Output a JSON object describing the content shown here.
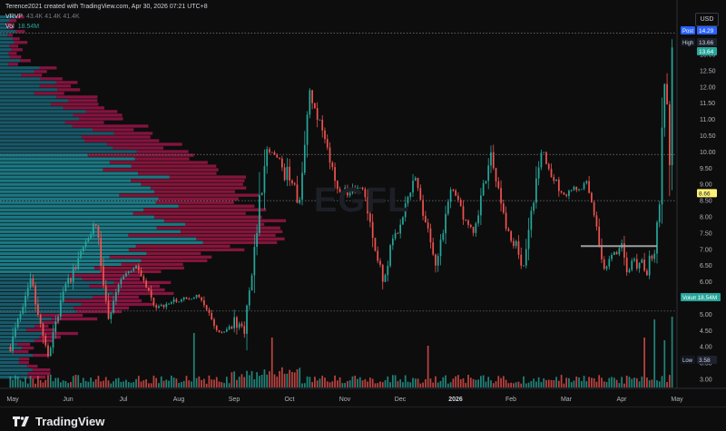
{
  "header": {
    "title": "Terence2021 created with TradingView.com, Apr 30, 2026 07:21 UTC+8",
    "indicator_name": "VRVP",
    "indicator_values": "43.4K 41.4K 41.4K",
    "volume_label": "Vol",
    "volume_value": "18.54M"
  },
  "watermark": "EGFL",
  "currency": "USD",
  "footer": {
    "brand": "TradingView"
  },
  "colors": {
    "background": "#0d0d0d",
    "up": "#26a69a",
    "down": "#ef5350",
    "profile_up": "#1e7d95",
    "profile_down": "#c2185b",
    "value_area_up": "#26c6da",
    "value_area_down": "#e91e63",
    "post_badge": "#2962ff",
    "poc_badge": "#fff176",
    "support_line": "#9e9e9e"
  },
  "chart_data": {
    "type": "candlestick",
    "symbol": "EGFL",
    "y_axis_ticks": [
      "13.00",
      "12.50",
      "12.00",
      "11.50",
      "11.00",
      "10.50",
      "10.00",
      "9.50",
      "9.00",
      "8.50",
      "8.00",
      "7.50",
      "7.00",
      "6.50",
      "6.00",
      "5.50",
      "5.00",
      "4.50",
      "4.00",
      "3.50",
      "3.00"
    ],
    "x_axis_ticks": [
      "May",
      "Jun",
      "Jul",
      "Aug",
      "Sep",
      "Oct",
      "Nov",
      "Dec",
      "2026",
      "Feb",
      "Mar",
      "Apr",
      "May"
    ],
    "ylim": [
      2.6,
      14.6
    ],
    "price_labels": [
      {
        "name": "Post",
        "value": "14.29",
        "kind": "post"
      },
      {
        "name": "High",
        "value": "13.66",
        "kind": "high"
      },
      {
        "name": "",
        "value": "13.64",
        "kind": "last"
      },
      {
        "name": "",
        "value": "8.66",
        "kind": "poc"
      },
      {
        "name": "Volume",
        "value": "18.54M",
        "kind": "volume"
      },
      {
        "name": "Low",
        "value": "3.58",
        "kind": "low"
      }
    ],
    "reference_lines": [
      {
        "value": 13.66,
        "style": "dotted"
      },
      {
        "value": 9.92,
        "style": "dotted"
      },
      {
        "value": 8.5,
        "style": "dotted"
      },
      {
        "value": 5.1,
        "style": "dotted"
      }
    ],
    "support_line": {
      "value": 7.1,
      "from": "Mar",
      "to": "Apr"
    },
    "monthly_ohlc": [
      {
        "month": "May",
        "open": 4.0,
        "high": 6.1,
        "low": 3.58,
        "close": 5.8
      },
      {
        "month": "Jun",
        "open": 5.8,
        "high": 7.8,
        "low": 4.8,
        "close": 6.1
      },
      {
        "month": "Jul",
        "open": 6.1,
        "high": 6.5,
        "low": 5.2,
        "close": 5.4
      },
      {
        "month": "Aug",
        "open": 5.4,
        "high": 5.6,
        "low": 4.4,
        "close": 4.6
      },
      {
        "month": "Sep",
        "open": 4.6,
        "high": 10.3,
        "low": 4.4,
        "close": 9.4
      },
      {
        "month": "Oct",
        "open": 9.4,
        "high": 11.9,
        "low": 8.4,
        "close": 8.8
      },
      {
        "month": "Nov",
        "open": 8.8,
        "high": 8.9,
        "low": 6.0,
        "close": 7.6
      },
      {
        "month": "Dec",
        "open": 7.6,
        "high": 9.2,
        "low": 6.5,
        "close": 8.7
      },
      {
        "month": "Jan",
        "open": 8.7,
        "high": 10.0,
        "low": 7.4,
        "close": 7.6
      },
      {
        "month": "Feb",
        "open": 7.6,
        "high": 10.0,
        "low": 6.5,
        "close": 8.6
      },
      {
        "month": "Mar",
        "open": 8.6,
        "high": 9.1,
        "low": 6.4,
        "close": 6.9
      },
      {
        "month": "Apr",
        "open": 6.9,
        "high": 13.66,
        "low": 6.2,
        "close": 13.64
      }
    ]
  }
}
